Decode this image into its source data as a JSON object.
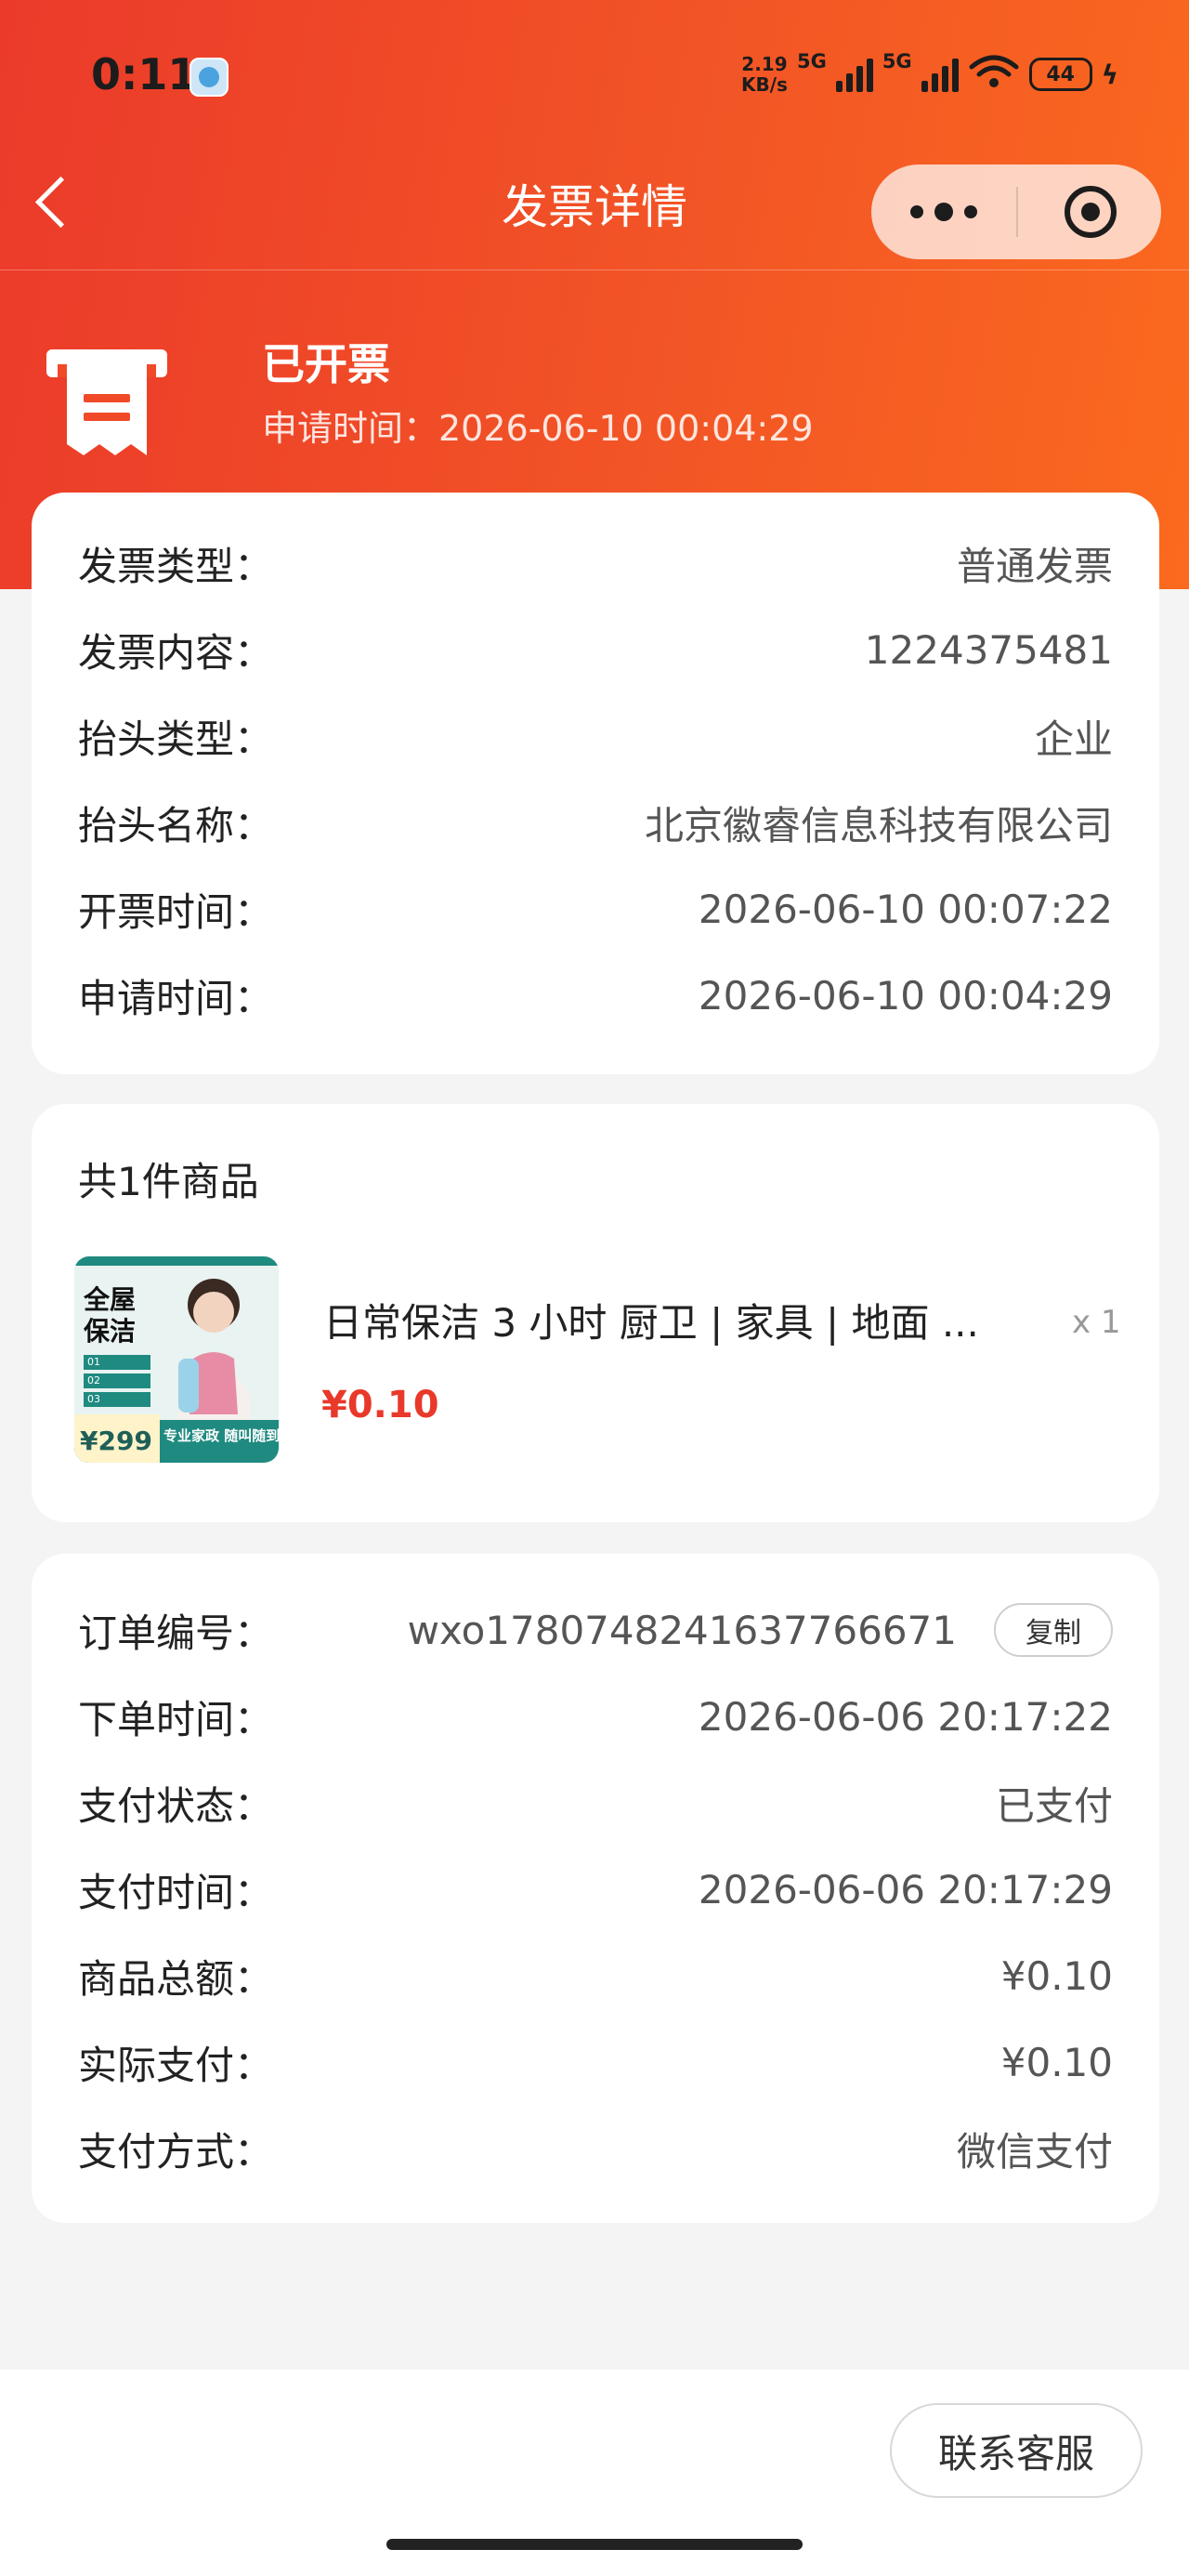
{
  "status_bar": {
    "time": "0:11",
    "speed_value": "2.19",
    "speed_unit": "KB/s",
    "network_1": "5G",
    "network_2": "5G",
    "wifi_level": "6",
    "battery": "44"
  },
  "nav": {
    "title": "发票详情"
  },
  "invoice_status": {
    "title": "已开票",
    "apply_time": "申请时间：2026-06-10 00:04:29"
  },
  "invoice_info": [
    {
      "label": "发票类型：",
      "value": "普通发票"
    },
    {
      "label": "发票内容：",
      "value": "1224375481"
    },
    {
      "label": "抬头类型：",
      "value": "企业"
    },
    {
      "label": "抬头名称：",
      "value": "北京徽睿信息科技有限公司"
    },
    {
      "label": "开票时间：",
      "value": "2026-06-10 00:07:22"
    },
    {
      "label": "申请时间：",
      "value": "2026-06-10 00:04:29"
    }
  ],
  "goods": {
    "header": "共1件商品",
    "items": [
      {
        "name": "日常保洁 3 小时 厨卫 | 家具 | 地面 ...",
        "qty": "x 1",
        "price": "¥0.10",
        "thumb": {
          "title_1": "全屋",
          "title_2": "保洁",
          "step_1": "01",
          "step_2": "02",
          "step_3": "03",
          "promo_price": "¥299",
          "banner": "专业家政 随叫随到"
        }
      }
    ]
  },
  "order": {
    "order_no": {
      "label": "订单编号：",
      "value": "wxo1780748241637766671",
      "copy_label": "复制"
    },
    "rows": [
      {
        "label": "下单时间：",
        "value": "2026-06-06 20:17:22"
      },
      {
        "label": "支付状态：",
        "value": "已支付"
      },
      {
        "label": "支付时间：",
        "value": "2026-06-06 20:17:29"
      },
      {
        "label": "商品总额：",
        "value": "¥0.10"
      },
      {
        "label": "实际支付：",
        "value": "¥0.10"
      },
      {
        "label": "支付方式：",
        "value": "微信支付"
      }
    ]
  },
  "footer": {
    "contact_label": "联系客服"
  },
  "colors": {
    "accent": "#eb3a2a",
    "accent_end": "#fb6a1e",
    "price": "#e8392a",
    "teal": "#1f8a80"
  }
}
